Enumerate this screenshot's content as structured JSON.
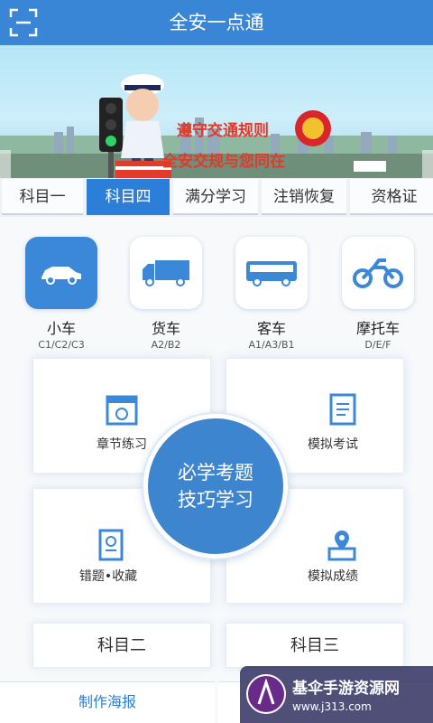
{
  "app": {
    "title": "全安一点通"
  },
  "banner": {
    "slogan_line1": "遵守交通规则",
    "slogan_line2": "全安交规与您同在"
  },
  "tabs": [
    {
      "label": "科目一"
    },
    {
      "label": "科目四"
    },
    {
      "label": "满分学习"
    },
    {
      "label": "注销恢复"
    },
    {
      "label": "资格证"
    }
  ],
  "vehicles": [
    {
      "name": "小车",
      "classes": "C1/C2/C3",
      "icon": "car-icon"
    },
    {
      "name": "货车",
      "classes": "A2/B2",
      "icon": "truck-icon"
    },
    {
      "name": "客车",
      "classes": "A1/A3/B1",
      "icon": "bus-icon"
    },
    {
      "name": "摩托车",
      "classes": "D/E/F",
      "icon": "motorcycle-icon"
    }
  ],
  "cards": {
    "chapter": "章节练习",
    "mock_exam": "模拟考试",
    "wrong_fav": "错题•收藏",
    "mock_score": "模拟成绩"
  },
  "center": {
    "line1": "必学考题",
    "line2": "技巧学习"
  },
  "subjects": {
    "two": "科目二",
    "three": "科目三"
  },
  "bottom": {
    "poster": "制作海报"
  },
  "watermark": {
    "title": "基伞手游资源网",
    "url": "www.j313.com"
  },
  "colors": {
    "primary": "#3a86d6",
    "slogan": "#e03a2a"
  }
}
